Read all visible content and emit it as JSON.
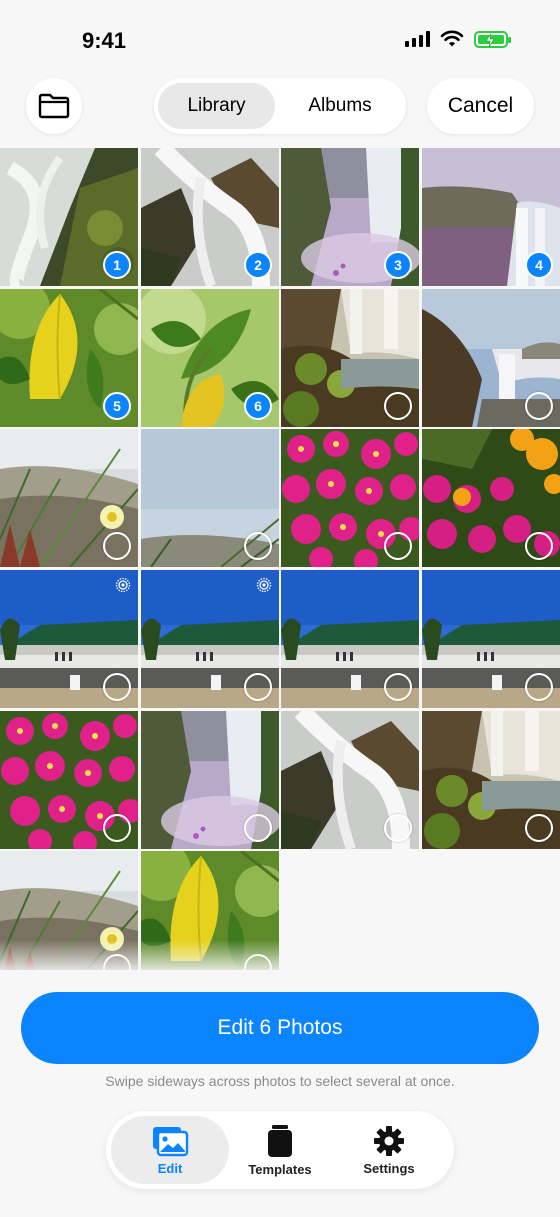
{
  "status_bar": {
    "time": "9:41"
  },
  "top_bar": {
    "folder_icon": "folder-icon",
    "tabs": [
      {
        "label": "Library",
        "active": true
      },
      {
        "label": "Albums",
        "active": false
      }
    ],
    "cancel_label": "Cancel"
  },
  "photos": [
    {
      "kind": "waterfall-rock",
      "selection": "1"
    },
    {
      "kind": "waterfall-cascade",
      "selection": "2"
    },
    {
      "kind": "waterfall-mist",
      "selection": "3"
    },
    {
      "kind": "waterfall-cliff",
      "selection": "4"
    },
    {
      "kind": "yellow-leaf",
      "selection": "5"
    },
    {
      "kind": "green-leaves",
      "selection": "6"
    },
    {
      "kind": "falls-rocks",
      "selection": ""
    },
    {
      "kind": "falls-sky",
      "selection": ""
    },
    {
      "kind": "dune-flower",
      "selection": ""
    },
    {
      "kind": "sky-grass",
      "selection": ""
    },
    {
      "kind": "magenta-flowers",
      "selection": ""
    },
    {
      "kind": "magenta-yellow-flowers",
      "selection": ""
    },
    {
      "kind": "building",
      "selection": "",
      "live": true
    },
    {
      "kind": "building",
      "selection": "",
      "live": true
    },
    {
      "kind": "building",
      "selection": ""
    },
    {
      "kind": "building",
      "selection": ""
    },
    {
      "kind": "magenta-flowers",
      "selection": ""
    },
    {
      "kind": "waterfall-mist",
      "selection": ""
    },
    {
      "kind": "waterfall-cascade",
      "selection": ""
    },
    {
      "kind": "falls-rocks",
      "selection": ""
    },
    {
      "kind": "dune-flower",
      "selection": ""
    },
    {
      "kind": "yellow-leaf",
      "selection": ""
    }
  ],
  "edit_button_label": "Edit 6 Photos",
  "hint_text": "Swipe sideways across photos to select several at once.",
  "tabbar": {
    "items": [
      {
        "label": "Edit",
        "icon": "photos-icon",
        "active": true
      },
      {
        "label": "Templates",
        "icon": "templates-icon",
        "active": false
      },
      {
        "label": "Settings",
        "icon": "gear-icon",
        "active": false
      }
    ]
  },
  "colors": {
    "accent": "#0a84ff",
    "battery": "#2ecc40"
  }
}
